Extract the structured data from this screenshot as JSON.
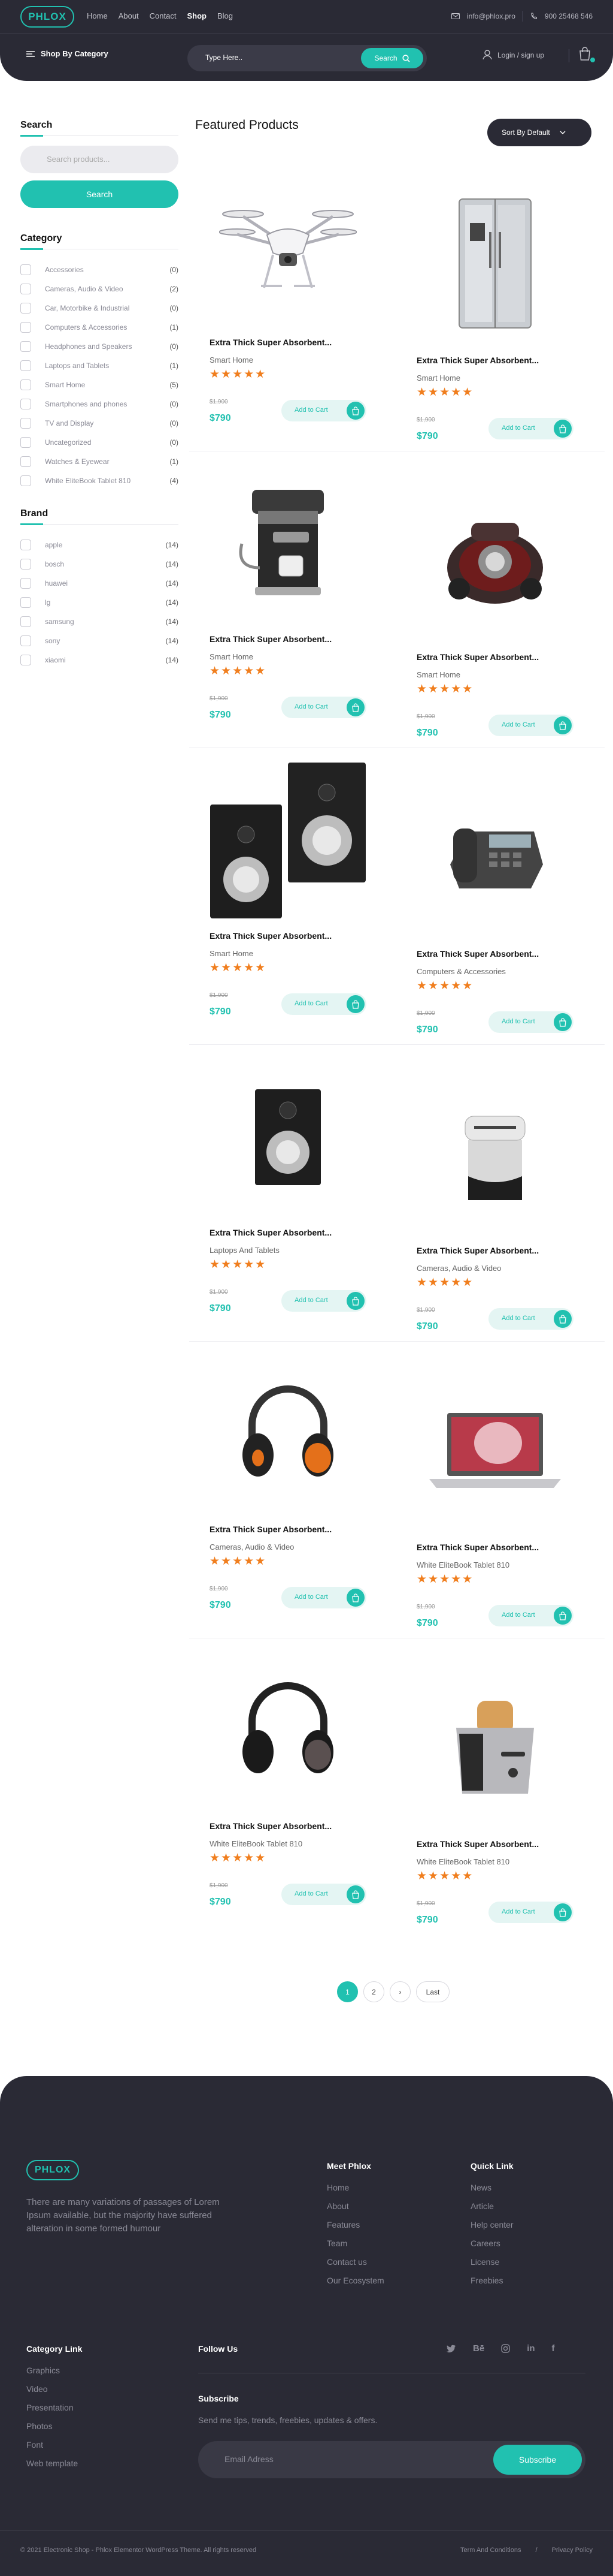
{
  "header": {
    "logo": "PHLOX",
    "nav": [
      "Home",
      "About",
      "Contact",
      "Shop",
      "Blog"
    ],
    "active_nav": "Shop",
    "email": "info@phlox.pro",
    "phone": "900 25468 546",
    "category_label": "Shop By Category",
    "search_placeholder": "Type Here..",
    "search_button": "Search",
    "login": "Login / sign up"
  },
  "sidebar": {
    "search_title": "Search",
    "search_placeholder": "Search products...",
    "search_button": "Search",
    "category_title": "Category",
    "categories": [
      {
        "name": "Accessories",
        "count": "(0)"
      },
      {
        "name": "Cameras, Audio & Video",
        "count": "(2)"
      },
      {
        "name": "Car, Motorbike & Industrial",
        "count": "(0)"
      },
      {
        "name": "Computers & Accessories",
        "count": "(1)"
      },
      {
        "name": "Headphones and Speakers",
        "count": "(0)"
      },
      {
        "name": "Laptops and Tablets",
        "count": "(1)"
      },
      {
        "name": "Smart Home",
        "count": "(5)"
      },
      {
        "name": "Smartphones and phones",
        "count": "(0)"
      },
      {
        "name": "TV and Display",
        "count": "(0)"
      },
      {
        "name": "Uncategorized",
        "count": "(0)"
      },
      {
        "name": "Watches & Eyewear",
        "count": "(1)"
      },
      {
        "name": "White EliteBook Tablet 810",
        "count": "(4)"
      }
    ],
    "brand_title": "Brand",
    "brands": [
      {
        "name": "apple",
        "count": "(14)"
      },
      {
        "name": "bosch",
        "count": "(14)"
      },
      {
        "name": "huawei",
        "count": "(14)"
      },
      {
        "name": "lg",
        "count": "(14)"
      },
      {
        "name": "samsung",
        "count": "(14)"
      },
      {
        "name": "sony",
        "count": "(14)"
      },
      {
        "name": "xiaomi",
        "count": "(14)"
      }
    ]
  },
  "main": {
    "title": "Featured Products",
    "sort_label": "Sort By Default",
    "add_to_cart": "Add to Cart",
    "products": [
      {
        "name": "Extra Thick Super Absorbent...",
        "category": "Smart Home",
        "old_price": "$1,900",
        "price": "$790",
        "stars": "★★★★★",
        "image": "drone"
      },
      {
        "name": "Extra Thick Super Absorbent...",
        "category": "Smart Home",
        "old_price": "$1,900",
        "price": "$790",
        "stars": "★★★★★",
        "image": "fridge"
      },
      {
        "name": "Extra Thick Super Absorbent...",
        "category": "Smart Home",
        "old_price": "$1,900",
        "price": "$790",
        "stars": "★★★★★",
        "image": "coffee-machine"
      },
      {
        "name": "Extra Thick Super Absorbent...",
        "category": "Smart Home",
        "old_price": "$1,900",
        "price": "$790",
        "stars": "★★★★★",
        "image": "vacuum"
      },
      {
        "name": "Extra Thick Super Absorbent...",
        "category": "Smart Home",
        "old_price": "$1,900",
        "price": "$790",
        "stars": "★★★★★",
        "image": "speakers"
      },
      {
        "name": "Extra Thick Super Absorbent...",
        "category": "Computers & Accessories",
        "old_price": "$1,900",
        "price": "$790",
        "stars": "★★★★★",
        "image": "phone"
      },
      {
        "name": "Extra Thick Super Absorbent...",
        "category": "Laptops And Tablets",
        "old_price": "$1,900",
        "price": "$790",
        "stars": "★★★★★",
        "image": "speaker"
      },
      {
        "name": "Extra Thick Super Absorbent...",
        "category": "Cameras, Audio & Video",
        "old_price": "$1,900",
        "price": "$790",
        "stars": "★★★★★",
        "image": "shredder"
      },
      {
        "name": "Extra Thick Super Absorbent...",
        "category": "Cameras, Audio & Video",
        "old_price": "$1,900",
        "price": "$790",
        "stars": "★★★★★",
        "image": "headphones-orange"
      },
      {
        "name": "Extra Thick Super Absorbent...",
        "category": "White EliteBook Tablet 810",
        "old_price": "$1,900",
        "price": "$790",
        "stars": "★★★★★",
        "image": "laptop"
      },
      {
        "name": "Extra Thick Super Absorbent...",
        "category": "White EliteBook Tablet 810",
        "old_price": "$1,900",
        "price": "$790",
        "stars": "★★★★★",
        "image": "headphones-black"
      },
      {
        "name": "Extra Thick Super Absorbent...",
        "category": "White EliteBook Tablet 810",
        "old_price": "$1,900",
        "price": "$790",
        "stars": "★★★★★",
        "image": "toaster"
      }
    ]
  },
  "pagination": {
    "pages": [
      "1",
      "2"
    ],
    "next": "›",
    "last": "Last",
    "current": "1"
  },
  "footer": {
    "logo": "PHLOX",
    "description": "There are many variations of passages of Lorem Ipsum available, but the majority have suffered alteration in some formed humour",
    "meet_title": "Meet Phlox",
    "meet_links": [
      "Home",
      "About",
      "Features",
      "Team",
      "Contact us",
      "Our Ecosystem"
    ],
    "quick_title": "Quick Link",
    "quick_links": [
      "News",
      "Article",
      "Help center",
      "Careers",
      "License",
      "Freebies"
    ],
    "category_title": "Category Link",
    "category_links": [
      "Graphics",
      "Video",
      "Presentation",
      "Photos",
      "Font",
      "Web template"
    ],
    "follow_title": "Follow Us",
    "social": [
      "twitter-icon",
      "behance-icon",
      "instagram-icon",
      "linkedin-icon",
      "facebook-icon"
    ],
    "subscribe_title": "Subscribe",
    "subscribe_text": "Send me tips, trends, freebies, updates & offers.",
    "email_placeholder": "Email Adress",
    "subscribe_button": "Subscribe",
    "copyright": "© 2021 Electronic Shop - Phlox Elementor WordPress Theme. All rights reserved",
    "terms": "Term And Conditions",
    "divider": "/",
    "privacy": "Privacy Policy"
  },
  "colors": {
    "accent": "#21c1b0",
    "dark": "#2a2a35",
    "star": "#f07e1e"
  }
}
